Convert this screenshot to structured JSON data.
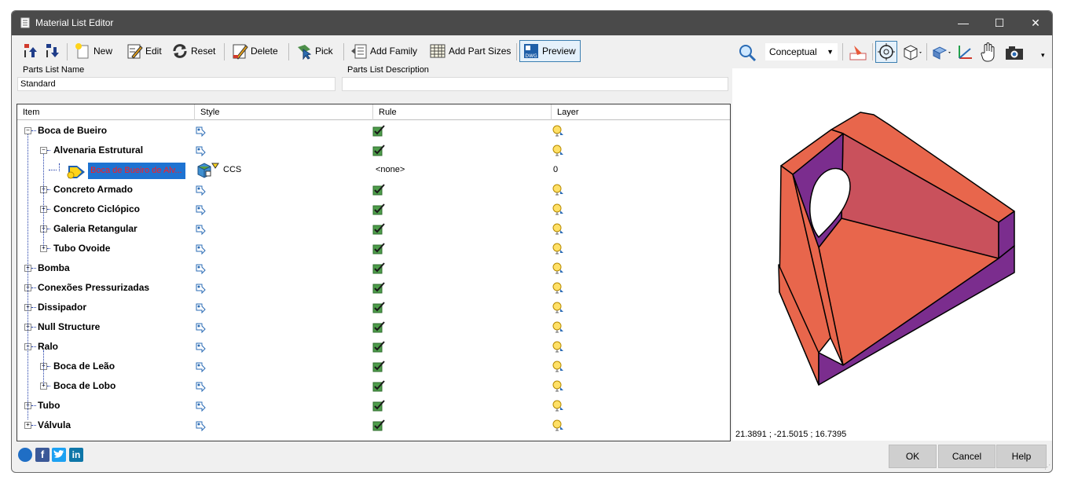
{
  "window": {
    "title": "Material List Editor",
    "minimize": "—",
    "maximize": "☐",
    "close": "✕"
  },
  "toolbar": {
    "new": "New",
    "edit": "Edit",
    "reset": "Reset",
    "delete": "Delete",
    "pick": "Pick",
    "add_family": "Add Family",
    "add_part_sizes": "Add Part Sizes",
    "preview": "Preview"
  },
  "fields": {
    "name_label": "Parts List Name",
    "name_value": "Standard",
    "desc_label": "Parts List Description",
    "desc_value": ""
  },
  "grid": {
    "columns": [
      "Item",
      "Style",
      "Rule",
      "Layer"
    ],
    "rows": [
      {
        "label": "Boca de Bueiro",
        "level": 0,
        "expander": "−"
      },
      {
        "label": "Alvenaria Estrutural",
        "level": 1,
        "expander": "−"
      },
      {
        "label": "Boca de Bueiro de Alv...",
        "level": 2,
        "style": "CCS",
        "rule": "<none>",
        "layer": "0",
        "selected": true
      },
      {
        "label": "Concreto Armado",
        "level": 1,
        "expander": "+"
      },
      {
        "label": "Concreto Ciclópico",
        "level": 1,
        "expander": "+"
      },
      {
        "label": "Galeria Retangular",
        "level": 1,
        "expander": "+"
      },
      {
        "label": "Tubo Ovoide",
        "level": 1,
        "expander": "+"
      },
      {
        "label": "Bomba",
        "level": 0,
        "expander": "+"
      },
      {
        "label": "Conexões Pressurizadas",
        "level": 0,
        "expander": "+"
      },
      {
        "label": "Dissipador",
        "level": 0,
        "expander": "+"
      },
      {
        "label": "Null Structure",
        "level": 0,
        "expander": "+"
      },
      {
        "label": "Ralo",
        "level": 0,
        "expander": "−"
      },
      {
        "label": "Boca de Leão",
        "level": 1,
        "expander": "+"
      },
      {
        "label": "Boca de Lobo",
        "level": 1,
        "expander": "+"
      },
      {
        "label": "Tubo",
        "level": 0,
        "expander": "+"
      },
      {
        "label": "Válvula",
        "level": 0,
        "expander": "+"
      }
    ]
  },
  "preview": {
    "visual_style": "Conceptual",
    "coordinates": "21.3891 ; -21.5015 ; 16.7395",
    "colors": {
      "face_light": "#e8664c",
      "face_mid": "#c9515c",
      "face_dark": "#7b2d8e",
      "outline": "#000000"
    }
  },
  "footer": {
    "ok": "OK",
    "cancel": "Cancel",
    "help": "Help"
  },
  "social": {
    "facebook": "f",
    "linkedin": "in"
  }
}
